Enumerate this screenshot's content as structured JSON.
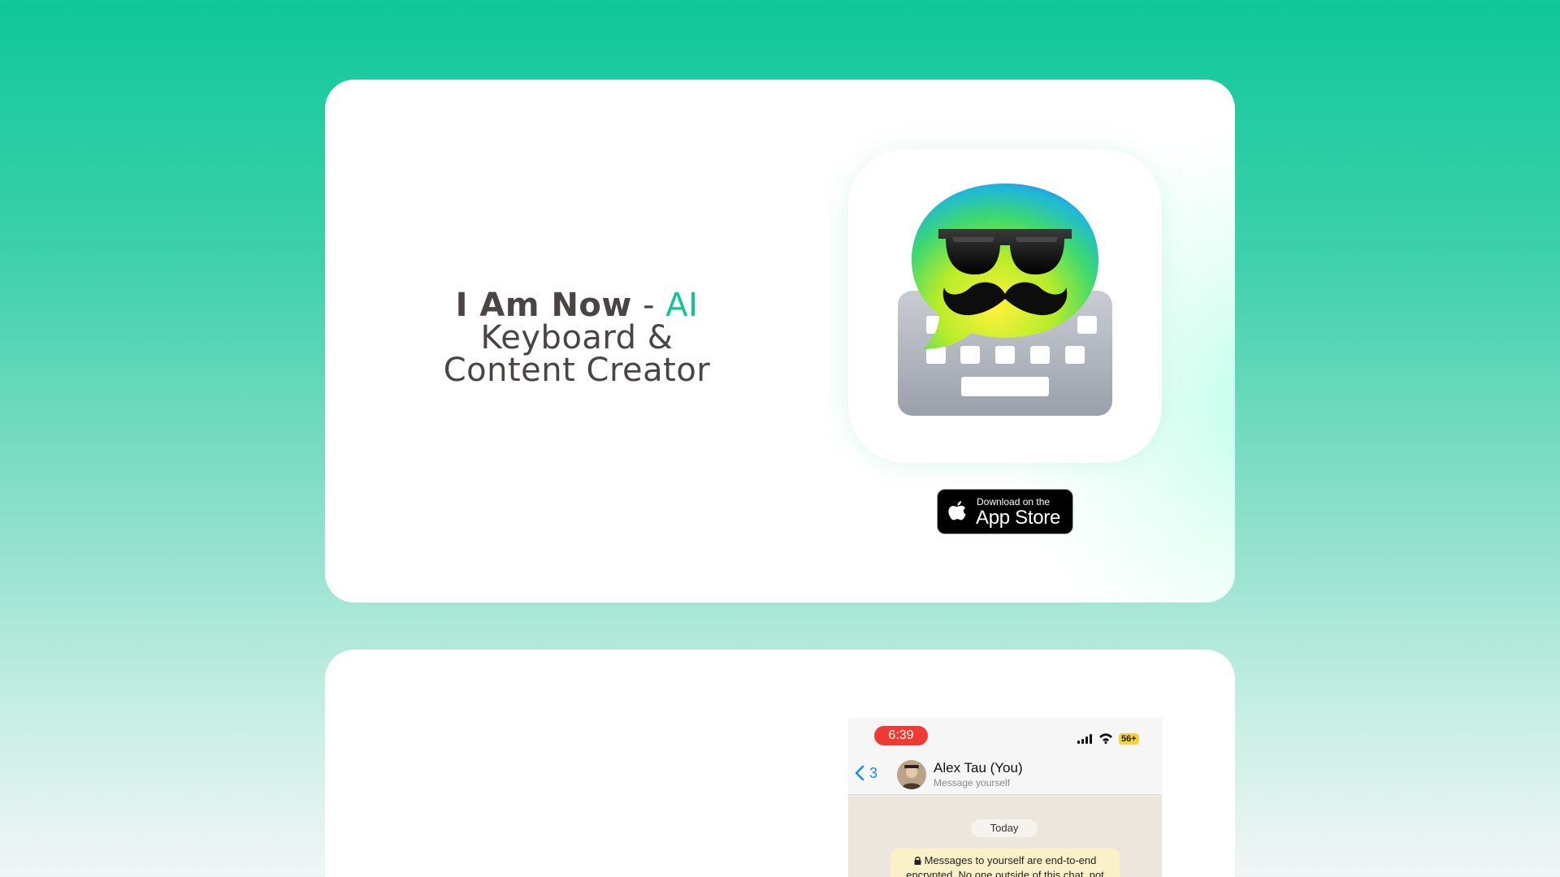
{
  "hero": {
    "title_strong": "I Am Now",
    "title_dash": " - ",
    "title_accent": "AI",
    "title_line2": "Keyboard &",
    "title_line3": "Content Creator",
    "app_icon": "app-icon-mustache-sunglasses-bubble-keyboard",
    "accent_color": "#12c39a",
    "badge": {
      "small": "Download on the",
      "big": "App Store",
      "icon": "apple-icon"
    }
  },
  "phone": {
    "time": "6:39",
    "battery": "56+",
    "back_count": "3",
    "contact_name": "Alex Tau (You)",
    "contact_sub": "Message yourself",
    "date_pill": "Today",
    "notice_line1": "Messages to yourself are end-to-end",
    "notice_line2": "encrypted. No one outside of this chat, not"
  },
  "colors": {
    "background_top": "#10c79a",
    "background_bottom": "#f2f5f6",
    "time_pill": "#ee3b33",
    "link_blue": "#1a8ce8"
  }
}
